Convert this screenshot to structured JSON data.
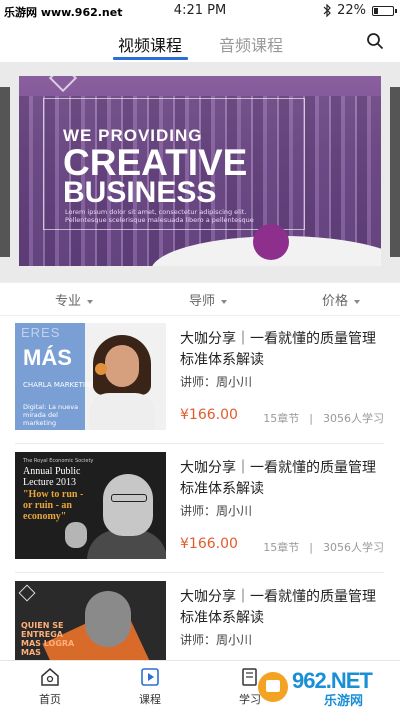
{
  "status": {
    "watermark": "乐游网 www.962.net",
    "time": "4:21 PM",
    "battery": "22%",
    "battery_level": 0.22
  },
  "tabs": {
    "video": "视频课程",
    "audio": "音频课程"
  },
  "banner": {
    "line1": "WE PROVIDING",
    "line2": "CREATIVE",
    "line3": "BUSINESS",
    "lorem": "Lorem ipsum dolor sit amet, consectetur adipiscing elit. Pellentesque scelerisque malesuada libero a pellentesque"
  },
  "filters": {
    "major": "专业",
    "teacher": "导师",
    "price": "价格"
  },
  "courses": [
    {
      "title": "大咖分享｜一看就懂的质量管理标准体系解读",
      "teacher": "讲师：周小川",
      "price": "¥166.00",
      "chapters": "15章节",
      "learners": "3056人学习",
      "thumb": {
        "eres": "ERES",
        "mas": "MÁS",
        "charla": "CHARLA MARKETING",
        "digital": "Digital: La nueva mirada del marketing"
      }
    },
    {
      "title": "大咖分享｜一看就懂的质量管理标准体系解读",
      "teacher": "讲师：周小川",
      "price": "¥166.00",
      "chapters": "15章节",
      "learners": "3056人学习",
      "thumb": {
        "small": "The Royal Economic Society",
        "heading": "Annual Public Lecture 2013",
        "quote": "\"How to run - or ruin - an economy\""
      }
    },
    {
      "title": "大咖分享｜一看就懂的质量管理标准体系解读",
      "teacher": "讲师：周小川",
      "thumb": {
        "text": "QUIEN SE ENTREGA MAS LOGRA MAS"
      }
    }
  ],
  "bottom_nav": {
    "home": "首页",
    "course": "课程",
    "study": "学习"
  },
  "site_watermark": {
    "logo": "962.NET",
    "sub": "乐游网"
  },
  "colors": {
    "accent": "#2b6fd6",
    "price": "#e25b2c"
  }
}
